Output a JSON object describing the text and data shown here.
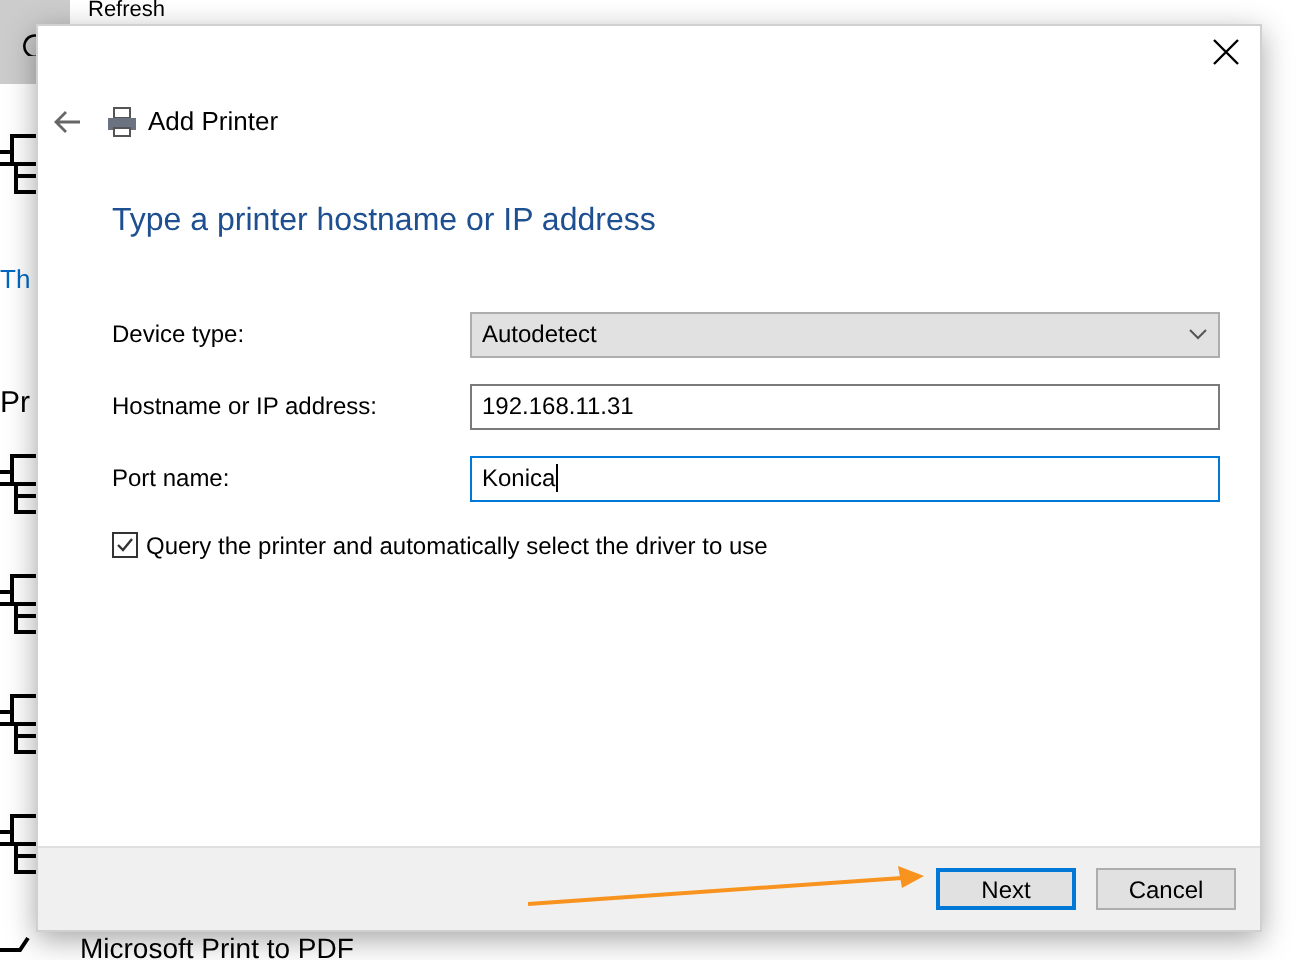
{
  "background": {
    "refresh_label": "Refresh",
    "link": "Th",
    "heading": "Pr",
    "printers": [
      {
        "name": "Microsoft Print to PDF"
      }
    ]
  },
  "dialog": {
    "title": "Add Printer",
    "heading": "Type a printer hostname or IP address",
    "fields": [
      {
        "label": "Device type:",
        "kind": "select",
        "value": "Autodetect",
        "focused": false
      },
      {
        "label": "Hostname or IP address:",
        "kind": "input",
        "value": "192.168.11.31",
        "focused": false
      },
      {
        "label": "Port name:",
        "kind": "input",
        "value": "Konica",
        "focused": true
      }
    ],
    "checkbox": {
      "label": "Query the printer and automatically select the driver to use",
      "checked": true
    },
    "buttons": [
      {
        "label": "Next",
        "default": true
      },
      {
        "label": "Cancel",
        "default": false
      }
    ]
  }
}
